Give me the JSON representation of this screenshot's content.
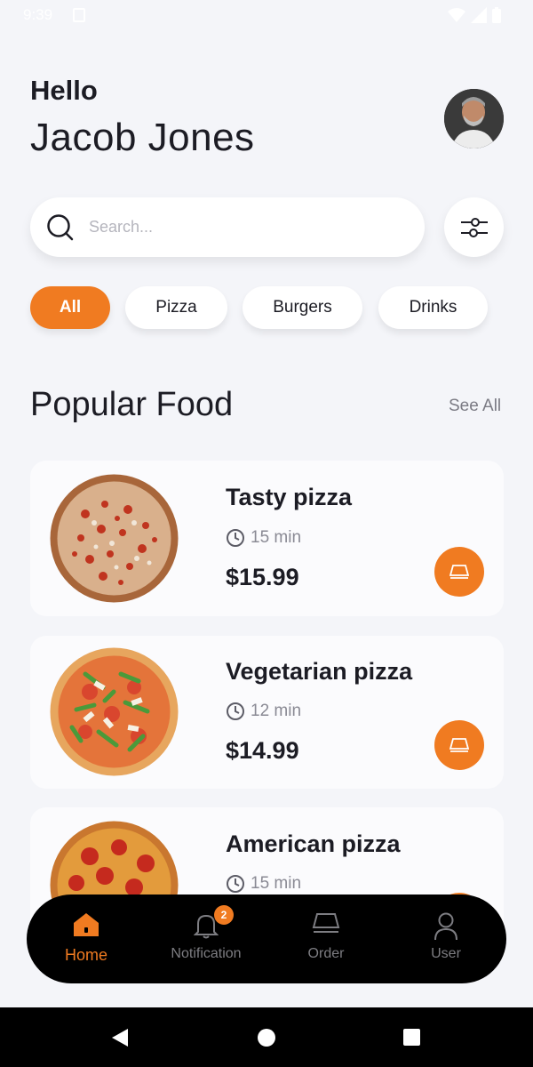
{
  "status_bar": {
    "time": "9:39"
  },
  "header": {
    "greeting": "Hello",
    "user_name": "Jacob Jones"
  },
  "search": {
    "placeholder": "Search...",
    "value": ""
  },
  "categories": [
    {
      "label": "All",
      "active": true
    },
    {
      "label": "Pizza",
      "active": false
    },
    {
      "label": "Burgers",
      "active": false
    },
    {
      "label": "Drinks",
      "active": false
    }
  ],
  "section": {
    "title": "Popular Food",
    "see_all": "See All"
  },
  "foods": [
    {
      "name": "Tasty pizza",
      "time": "15 min",
      "price": "$15.99"
    },
    {
      "name": "Vegetarian pizza",
      "time": "12 min",
      "price": "$14.99"
    },
    {
      "name": "American pizza",
      "time": "15 min",
      "price": ""
    }
  ],
  "bottom_nav": {
    "items": [
      {
        "label": "Home",
        "icon": "home-icon",
        "active": true
      },
      {
        "label": "Notification",
        "icon": "bell-icon",
        "active": false,
        "badge": "2"
      },
      {
        "label": "Order",
        "icon": "order-icon",
        "active": false
      },
      {
        "label": "User",
        "icon": "user-icon",
        "active": false
      }
    ]
  },
  "colors": {
    "accent": "#f07b21",
    "background": "#f4f5f9",
    "nav_background": "#000000"
  }
}
